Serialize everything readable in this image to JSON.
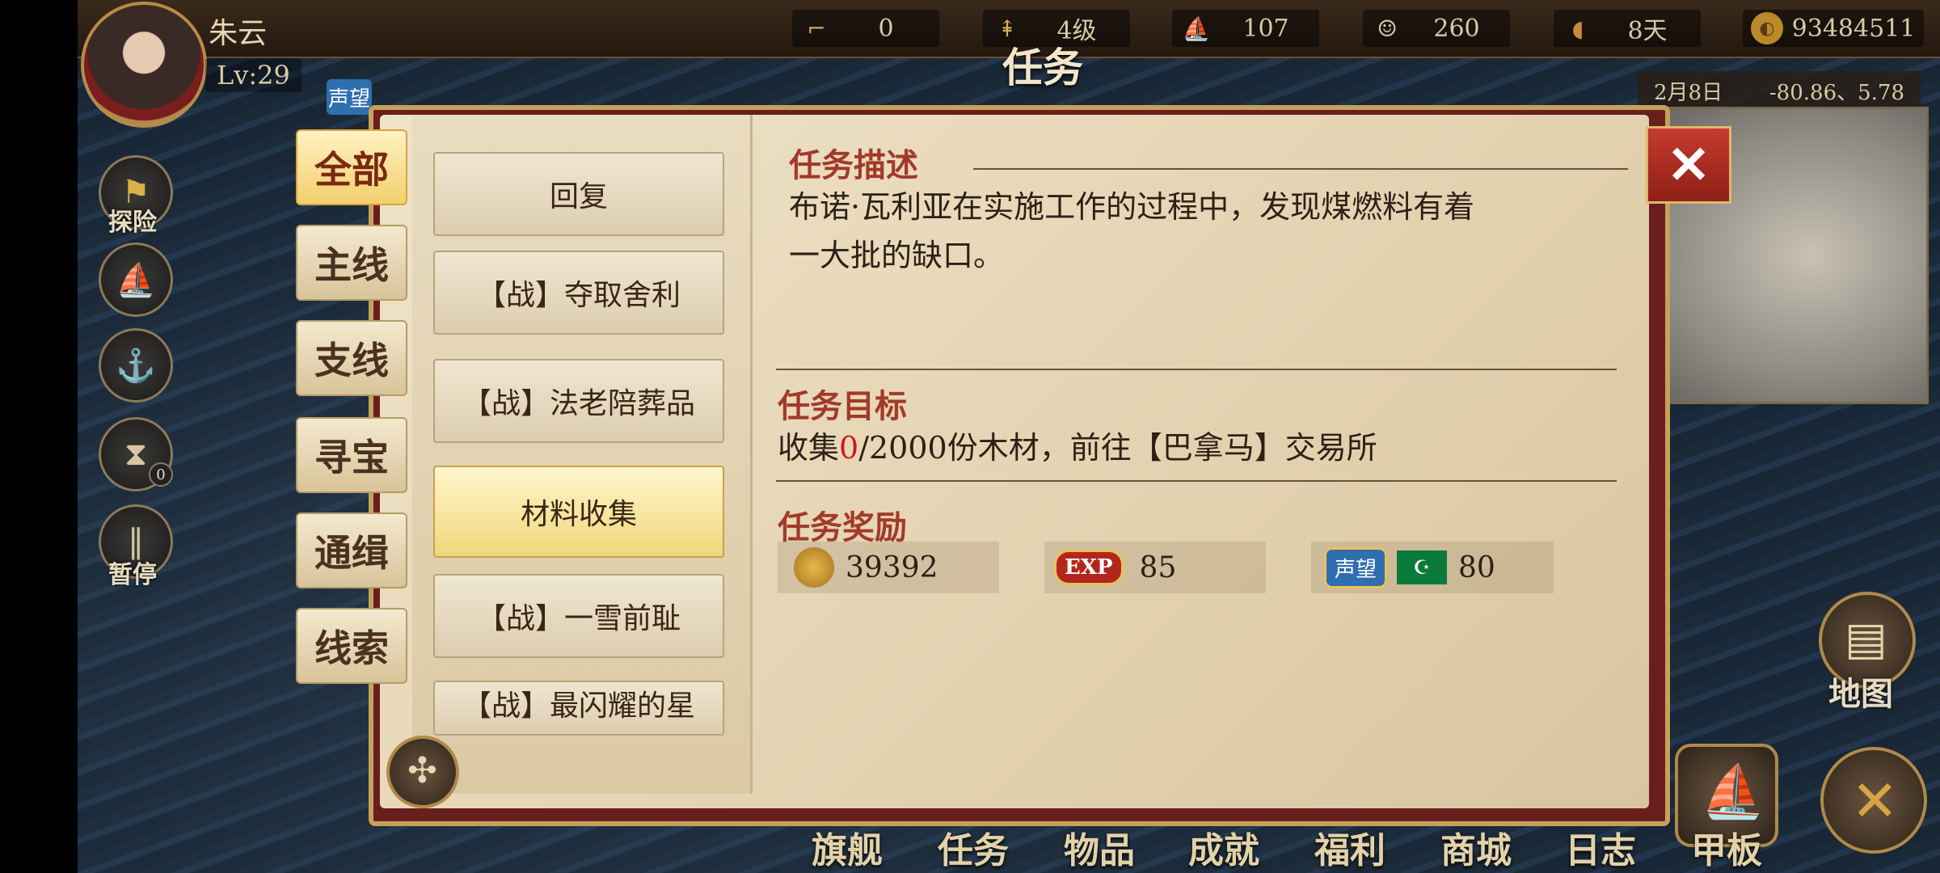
{
  "player": {
    "name": "朱云",
    "level": "Lv:29"
  },
  "resources": {
    "sailors": "0",
    "rank": "4级",
    "ships": "107",
    "crew": "260",
    "food": "8天",
    "gold": "93484511"
  },
  "window_title": "任务",
  "categories": [
    "全部",
    "主线",
    "支线",
    "寻宝",
    "通缉",
    "线索"
  ],
  "active_category": "全部",
  "quests": [
    "回复",
    "【战】夺取舍利",
    "【战】法老陪葬品",
    "材料收集",
    "【战】一雪前耻",
    "【战】最闪耀的星"
  ],
  "active_quest": "材料收集",
  "detail": {
    "desc_title": "任务描述",
    "desc_line1": "布诺·瓦利亚在实施工作的过程中，发现煤燃料有着",
    "desc_line2": "一大批的缺口。",
    "goal_title": "任务目标",
    "goal_prefix": "收集",
    "goal_progress": "0",
    "goal_suffix": "/2000份木材，前往【巴拿马】交易所",
    "reward_title": "任务奖励",
    "reward_gold": "39392",
    "reward_exp": "85",
    "reward_exp_label": "EXP",
    "reward_rep_label": "声望",
    "reward_rep": "80"
  },
  "left_menu": {
    "explore": "探险",
    "pause": "暂停",
    "hourglass_count": "0"
  },
  "small_tag": "声望",
  "minimap": {
    "date": "2月8日",
    "coords": "-80.86、5.78",
    "map_label": "地图"
  },
  "bottom_nav": [
    "旗舰",
    "任务",
    "物品",
    "成就",
    "福利",
    "商城",
    "日志",
    "甲板"
  ],
  "colors": {
    "accent_red": "#a23a2a",
    "progress_red": "#d01818",
    "active_gold": "#f2cf6c"
  }
}
